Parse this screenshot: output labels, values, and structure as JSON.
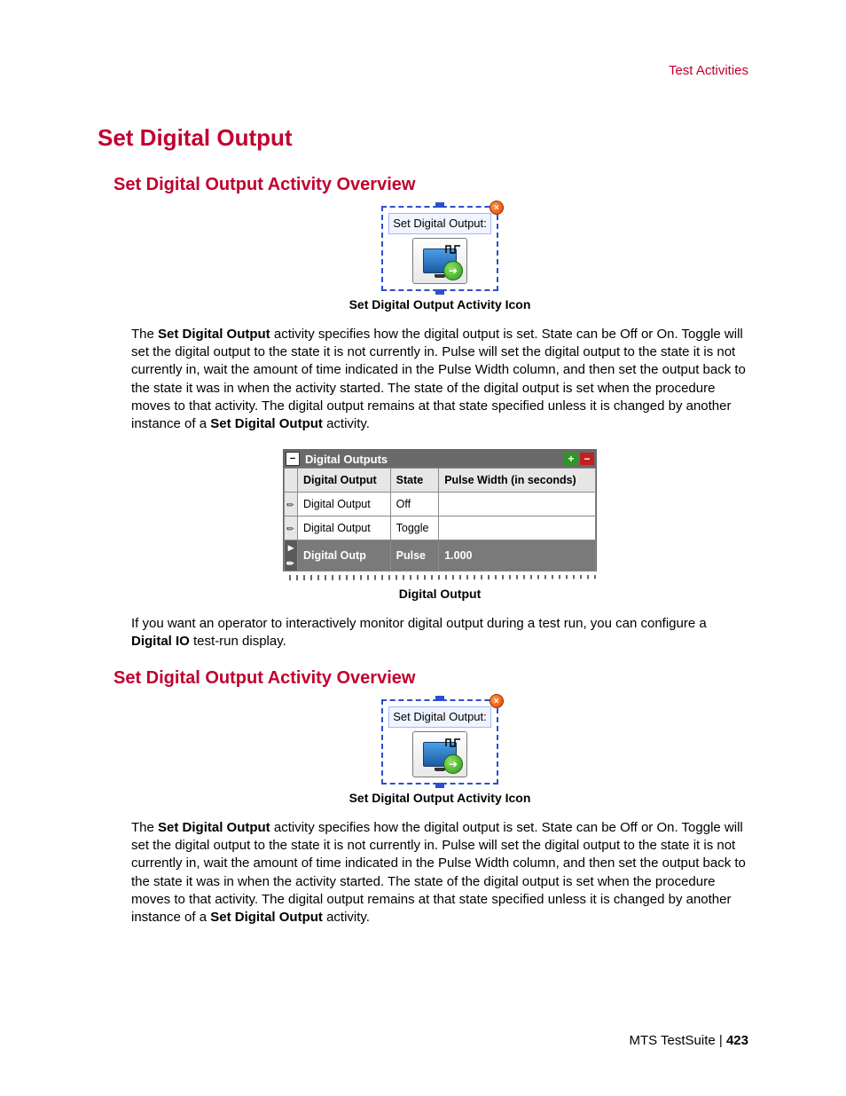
{
  "header": {
    "right": "Test Activities"
  },
  "headings": {
    "h1": "Set Digital Output",
    "h2": "Set Digital Output Activity Overview"
  },
  "figure1": {
    "label": "Set Digital Output:",
    "caption": "Set Digital Output Activity Icon"
  },
  "para1": {
    "pre": "The ",
    "bold1": "Set Digital Output",
    "mid": " activity specifies how the digital output is set. State can be Off or On. Toggle will set the digital output to the state it is not currently in. Pulse will set the digital output to the state it is not currently in, wait the amount of time indicated in the Pulse Width column, and then set the output back to the state it was in when the activity started. The state of the digital output is set when the procedure moves to that activity. The digital output remains at that state specified unless it is changed by another instance of a ",
    "bold2": "Set Digital Output",
    "post": " activity."
  },
  "table": {
    "title": "Digital Outputs",
    "collapse_glyph": "−",
    "add_glyph": "+",
    "remove_glyph": "−",
    "headers": {
      "col1": "Digital Output",
      "col2": "State",
      "col3": "Pulse Width (in seconds)"
    },
    "rows": [
      {
        "name": "Digital Output",
        "state": "Off",
        "pulse": ""
      },
      {
        "name": "Digital Output",
        "state": "Toggle",
        "pulse": ""
      },
      {
        "name": "Digital Outp",
        "state": "Pulse",
        "pulse": "1.000",
        "selected": true
      }
    ],
    "caption": "Digital Output"
  },
  "para2": {
    "pre": "If you want an operator to interactively monitor digital output during a test run, you can configure a ",
    "bold1": "Digital IO",
    "post": " test-run display."
  },
  "footer": {
    "product": "MTS TestSuite",
    "sep": " | ",
    "page": "423"
  },
  "chart_data": {
    "type": "table",
    "title": "Digital Outputs",
    "columns": [
      "Digital Output",
      "State",
      "Pulse Width (in seconds)"
    ],
    "rows": [
      [
        "Digital Output",
        "Off",
        ""
      ],
      [
        "Digital Output",
        "Toggle",
        ""
      ],
      [
        "Digital Outp",
        "Pulse",
        "1.000"
      ]
    ]
  }
}
